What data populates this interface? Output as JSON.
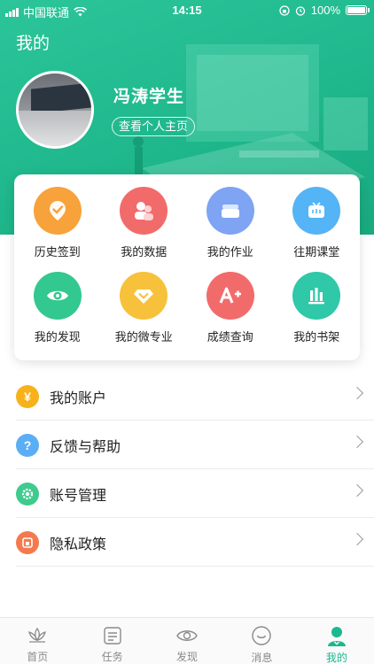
{
  "status_bar": {
    "carrier": "中国联通",
    "time": "14:15",
    "battery": "100%",
    "battery_level": 1.0
  },
  "header": {
    "title": "我的",
    "username": "冯涛学生",
    "profile_link": "查看个人主页"
  },
  "grid": {
    "items": [
      {
        "label": "历史签到",
        "icon": "check-badge-icon",
        "color": "#f7a23a"
      },
      {
        "label": "我的数据",
        "icon": "people-icon",
        "color": "#f26b6b"
      },
      {
        "label": "我的作业",
        "icon": "stack-icon",
        "color": "#7ea4f3"
      },
      {
        "label": "往期课堂",
        "icon": "tv-icon",
        "color": "#54b4f6"
      },
      {
        "label": "我的发现",
        "icon": "eye-icon",
        "color": "#33c88f"
      },
      {
        "label": "我的微专业",
        "icon": "diamond-icon",
        "color": "#f7c13b"
      },
      {
        "label": "成绩查询",
        "icon": "grade-a-plus-icon",
        "color": "#f26b6b"
      },
      {
        "label": "我的书架",
        "icon": "bookshelf-icon",
        "color": "#2fc8a8"
      }
    ]
  },
  "menu": {
    "items": [
      {
        "label": "我的账户",
        "icon": "yen-icon",
        "color": "#f7b21b",
        "glyph": "¥"
      },
      {
        "label": "反馈与帮助",
        "icon": "question-icon",
        "color": "#5aaef5",
        "glyph": "?"
      },
      {
        "label": "账号管理",
        "icon": "gear-icon",
        "color": "#3fca8e",
        "glyph": ""
      },
      {
        "label": "隐私政策",
        "icon": "privacy-icon",
        "color": "#f47a4e",
        "glyph": ""
      }
    ]
  },
  "tabbar": {
    "tabs": [
      {
        "label": "首页",
        "icon": "home-lotus-icon",
        "active": false
      },
      {
        "label": "任务",
        "icon": "task-icon",
        "active": false
      },
      {
        "label": "发现",
        "icon": "discover-eye-icon",
        "active": false
      },
      {
        "label": "消息",
        "icon": "message-icon",
        "active": false
      },
      {
        "label": "我的",
        "icon": "profile-icon",
        "active": true
      }
    ]
  },
  "colors": {
    "accent": "#1bb98d",
    "header_bg": "#22bd92"
  }
}
